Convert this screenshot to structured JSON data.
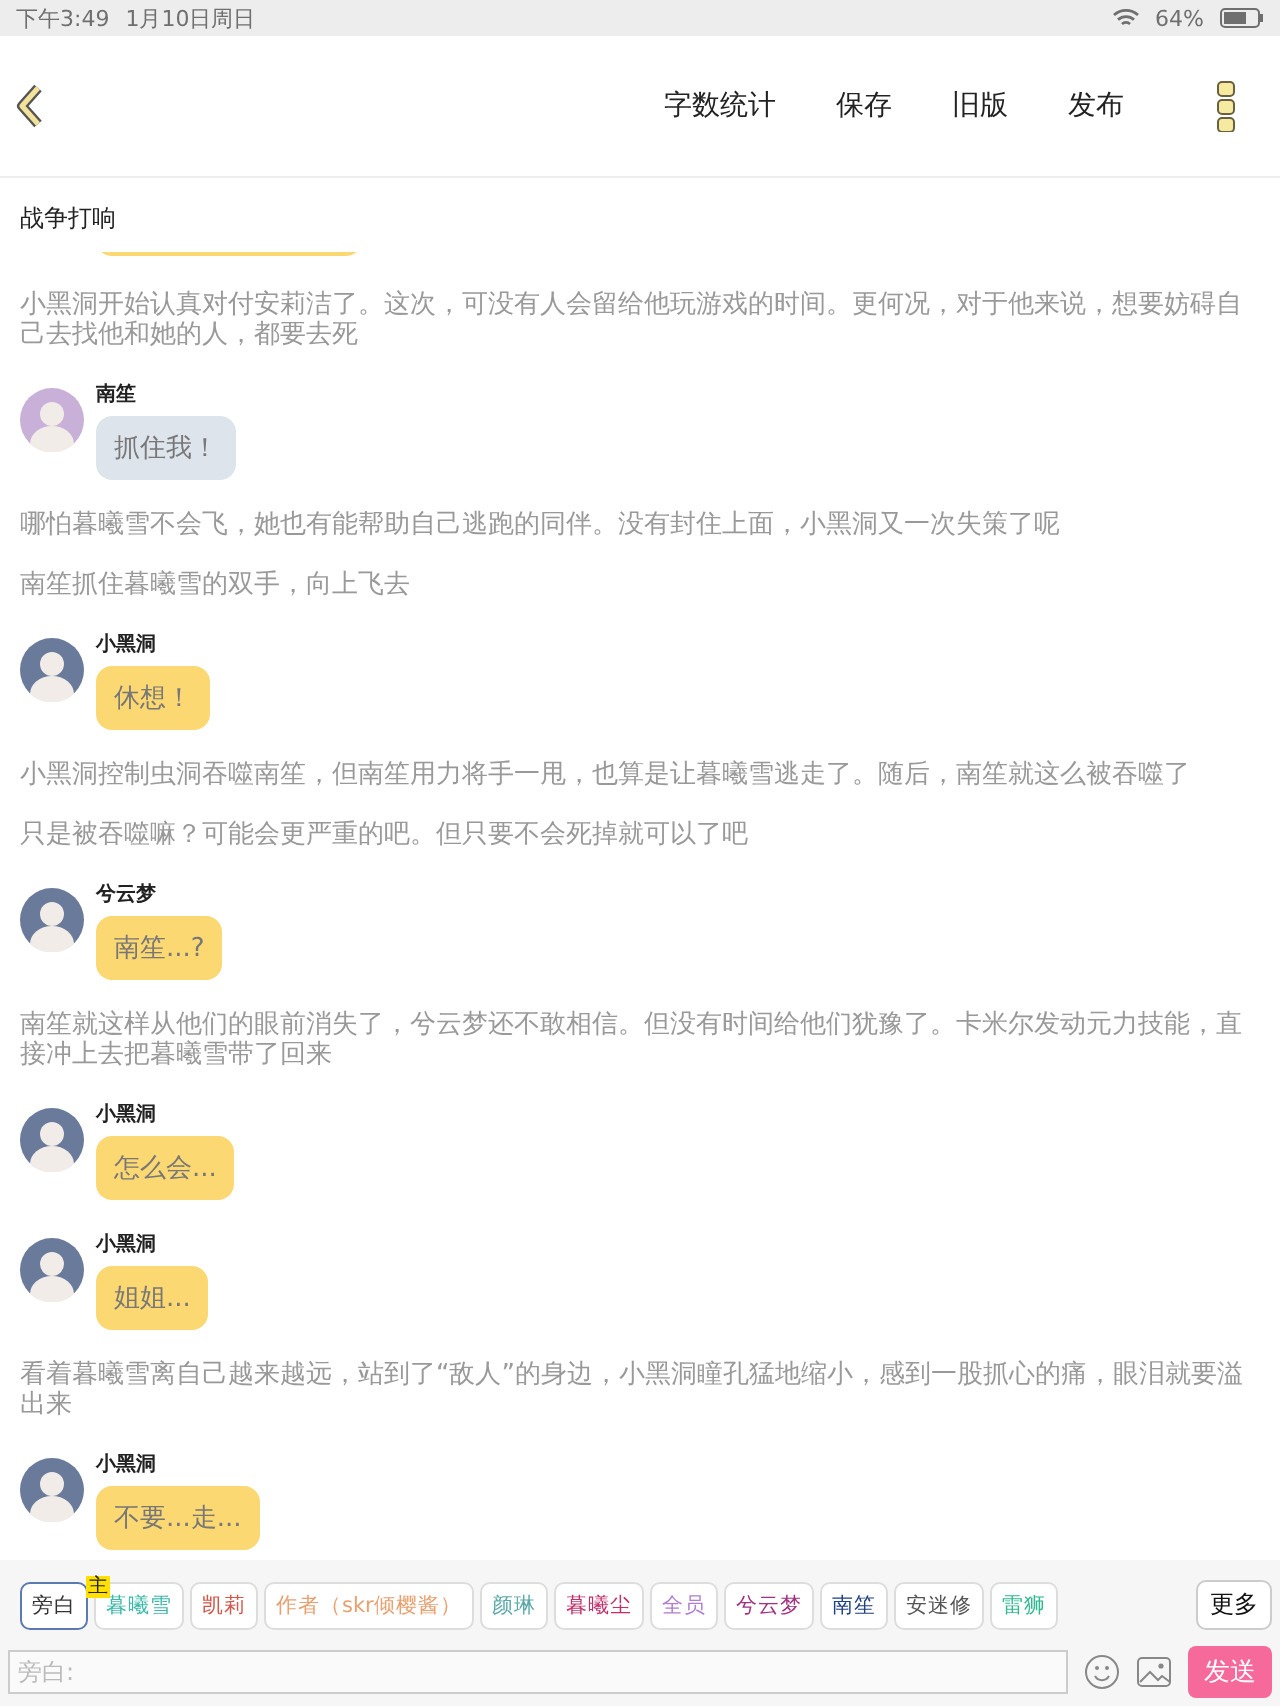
{
  "status_bar": {
    "time": "下午3:49",
    "date": "1月10日周日",
    "battery": "64%"
  },
  "toolbar": {
    "actions": [
      "字数统计",
      "保存",
      "旧版",
      "发布"
    ]
  },
  "title": "战争打响",
  "feed": [
    {
      "kind": "fragment",
      "color": "#fbd872"
    },
    {
      "kind": "narration",
      "text": "小黑洞开始认真对付安莉洁了。这次，可没有人会留给他玩游戏的时间。更何况，对于他来说，想要妨碍自己去找他和她的人，都要去死"
    },
    {
      "kind": "message",
      "speaker": "南笙",
      "text": "抓住我！",
      "color": "#dde4ec"
    },
    {
      "kind": "narration",
      "text": "哪怕暮曦雪不会飞，她也有能帮助自己逃跑的同伴。没有封住上面，小黑洞又一次失策了呢"
    },
    {
      "kind": "narration",
      "text": "南笙抓住暮曦雪的双手，向上飞去"
    },
    {
      "kind": "message",
      "speaker": "小黑洞",
      "text": "休想！",
      "color": "#fbd872"
    },
    {
      "kind": "narration",
      "text": "小黑洞控制虫洞吞噬南笙，但南笙用力将手一甩，也算是让暮曦雪逃走了。随后，南笙就这么被吞噬了"
    },
    {
      "kind": "narration",
      "text": "只是被吞噬嘛？可能会更严重的吧。但只要不会死掉就可以了吧"
    },
    {
      "kind": "message",
      "speaker": "兮云梦",
      "text": "南笙...?",
      "color": "#fbd872"
    },
    {
      "kind": "narration",
      "text": "南笙就这样从他们的眼前消失了，兮云梦还不敢相信。但没有时间给他们犹豫了。卡米尔发动元力技能，直接冲上去把暮曦雪带了回来"
    },
    {
      "kind": "message",
      "speaker": "小黑洞",
      "text": "怎么会...",
      "color": "#fbd872"
    },
    {
      "kind": "message",
      "speaker": "小黑洞",
      "text": "姐姐...",
      "color": "#fbd872"
    },
    {
      "kind": "narration",
      "text": "看着暮曦雪离自己越来越远，站到了“敌人”的身边，小黑洞瞳孔猛地缩小，感到一股抓心的痛，眼泪就要溢出来"
    },
    {
      "kind": "message",
      "speaker": "小黑洞",
      "text": "不要...走...",
      "color": "#fbd872"
    }
  ],
  "roles": [
    {
      "label": "旁白",
      "color": "#333333",
      "selected": true
    },
    {
      "label": "暮曦雪",
      "color": "#3bb8a8",
      "selected": false,
      "badge": "主"
    },
    {
      "label": "凯莉",
      "color": "#d0584a",
      "selected": false
    },
    {
      "label": "作者（skr倾樱酱）",
      "color": "#e8a070",
      "selected": false
    },
    {
      "label": "颜琳",
      "color": "#5aa8a8",
      "selected": false
    },
    {
      "label": "暮曦尘",
      "color": "#c0306a",
      "selected": false
    },
    {
      "label": "全员",
      "color": "#b080d0",
      "selected": false
    },
    {
      "label": "兮云梦",
      "color": "#a03080",
      "selected": false
    },
    {
      "label": "南笙",
      "color": "#204080",
      "selected": false
    },
    {
      "label": "安迷修",
      "color": "#555555",
      "selected": false
    },
    {
      "label": "雷狮",
      "color": "#30b890",
      "selected": false
    }
  ],
  "more_button": "更多",
  "input": {
    "placeholder": "旁白:"
  },
  "send_button": "发送"
}
